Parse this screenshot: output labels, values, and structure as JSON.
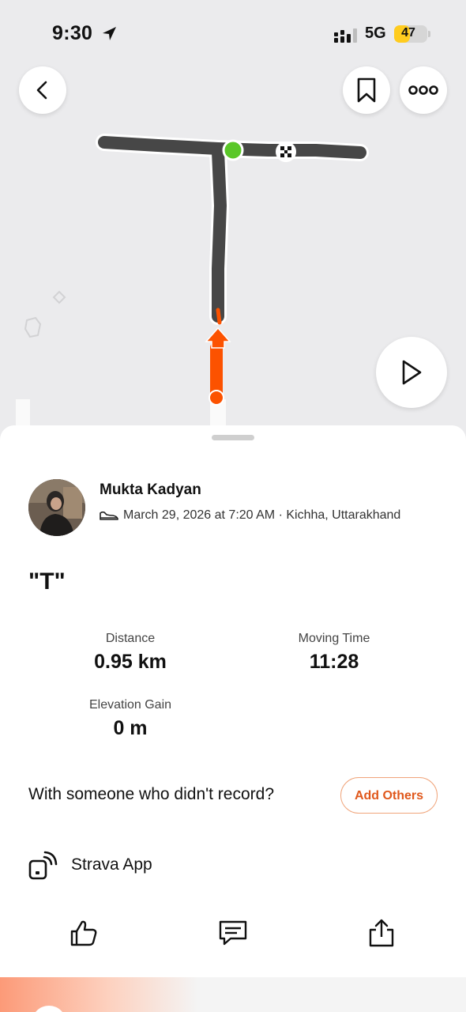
{
  "status_bar": {
    "time": "9:30",
    "network": "5G",
    "battery": "47",
    "battery_level": 0.47
  },
  "map": {
    "route_color": "#474747",
    "progress_color": "#fc5200",
    "start_marker_color": "#5ac728"
  },
  "activity": {
    "athlete_name": "Mukta Kadyan",
    "meta": "March 29, 2026 at 7:20 AM · Kichha, Uttarakhand",
    "title": "\"T\"",
    "stats": [
      {
        "label": "Distance",
        "value": "0.95 km"
      },
      {
        "label": "Moving Time",
        "value": "11:28"
      },
      {
        "label": "Elevation Gain",
        "value": "0 m"
      }
    ]
  },
  "with_others": {
    "prompt": "With someone who didn't record?",
    "button_label": "Add Others"
  },
  "device": {
    "label": "Strava App"
  },
  "icons": {
    "back": "chevron-left-icon",
    "bookmark": "bookmark-icon",
    "more": "more-icon",
    "play": "play-icon",
    "kudos": "thumbs-up-icon",
    "comment": "comment-icon",
    "share": "share-icon"
  },
  "colors": {
    "accent": "#fc5200",
    "add_button_border": "#f0a47a"
  }
}
